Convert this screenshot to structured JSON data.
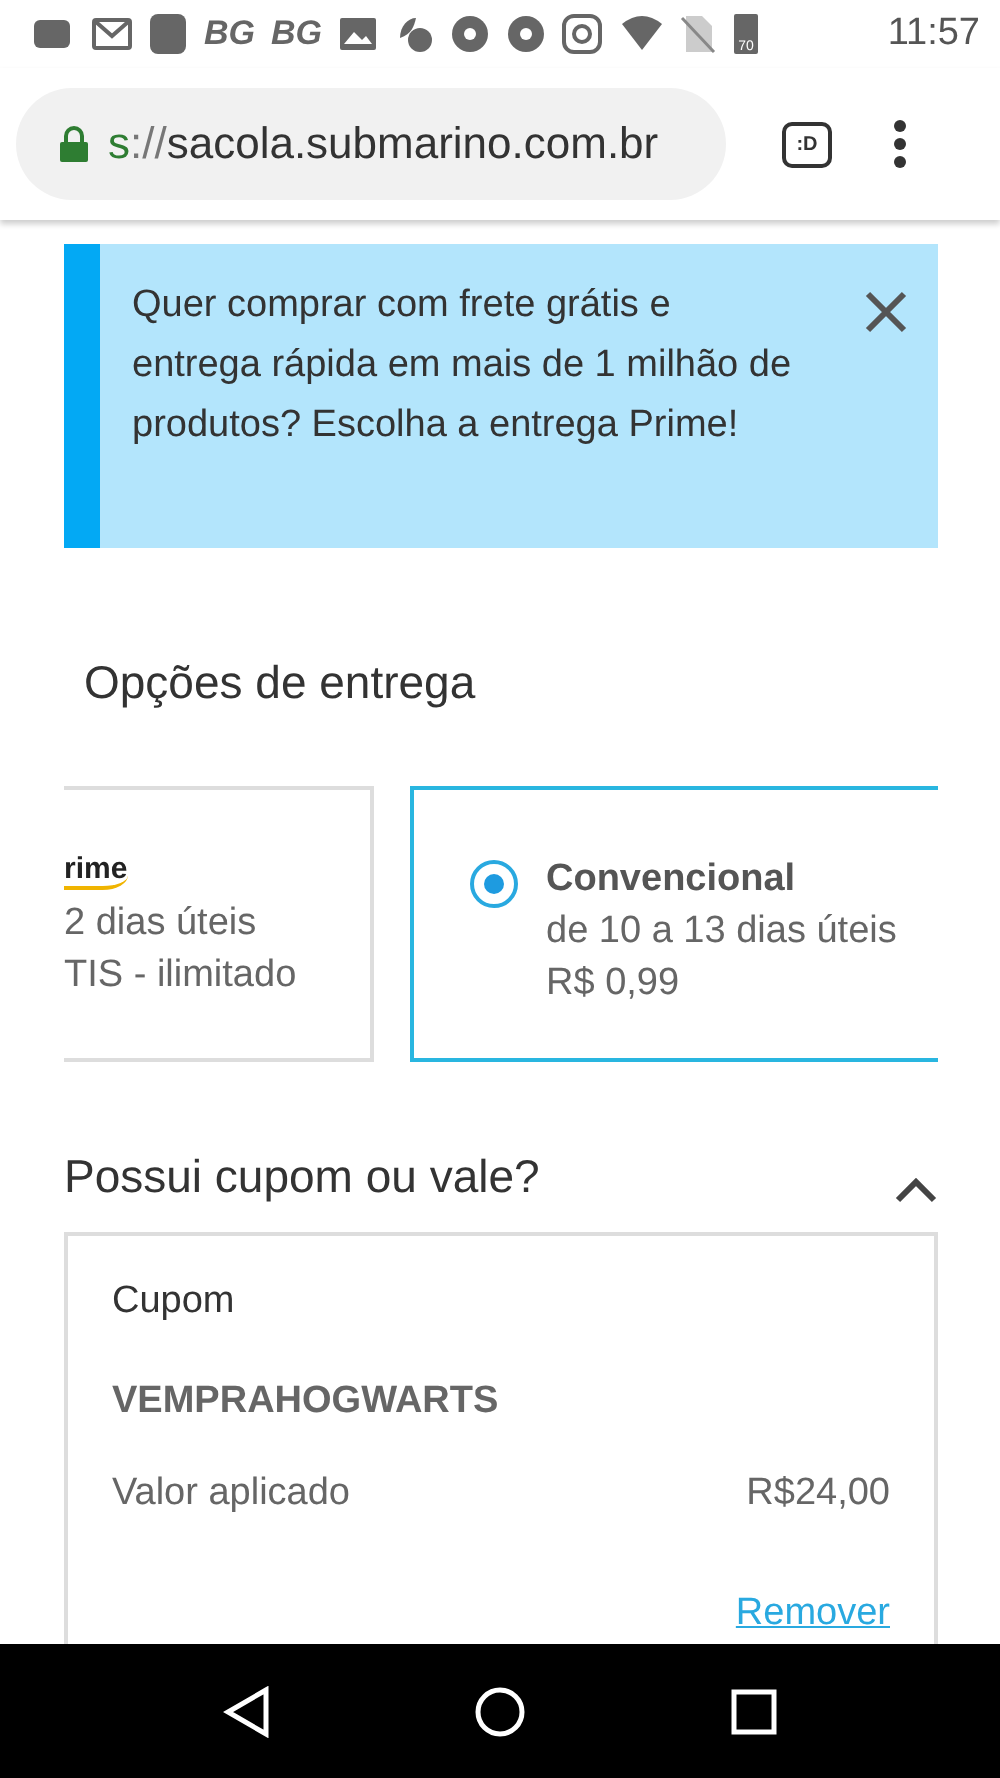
{
  "status_bar": {
    "badges": [
      "BG",
      "BG"
    ],
    "battery": "70",
    "time": "11:57"
  },
  "address_bar": {
    "scheme": "s",
    "separator": "://",
    "host": "sacola.submarino.com.br",
    "tab_label": ":D"
  },
  "banner": {
    "text": "Quer comprar com frete grátis e entrega rápida em mais de 1 milhão de produtos? Escolha a entrega Prime!"
  },
  "delivery": {
    "title": "Opções de entrega",
    "options": [
      {
        "kind": "prime",
        "logo": "rime",
        "lines": [
          "2 dias úteis",
          "TIS - ilimitado"
        ],
        "selected": false
      },
      {
        "kind": "standard",
        "name": "Convencional",
        "lines": [
          "de 10 a 13 dias úteis",
          "R$ 0,99"
        ],
        "selected": true
      }
    ]
  },
  "coupon": {
    "title": "Possui cupom ou vale?",
    "expanded": true,
    "label": "Cupom",
    "code": "VEMPRAHOGWARTS",
    "value_label": "Valor aplicado",
    "value": "R$24,00",
    "remove": "Remover"
  }
}
